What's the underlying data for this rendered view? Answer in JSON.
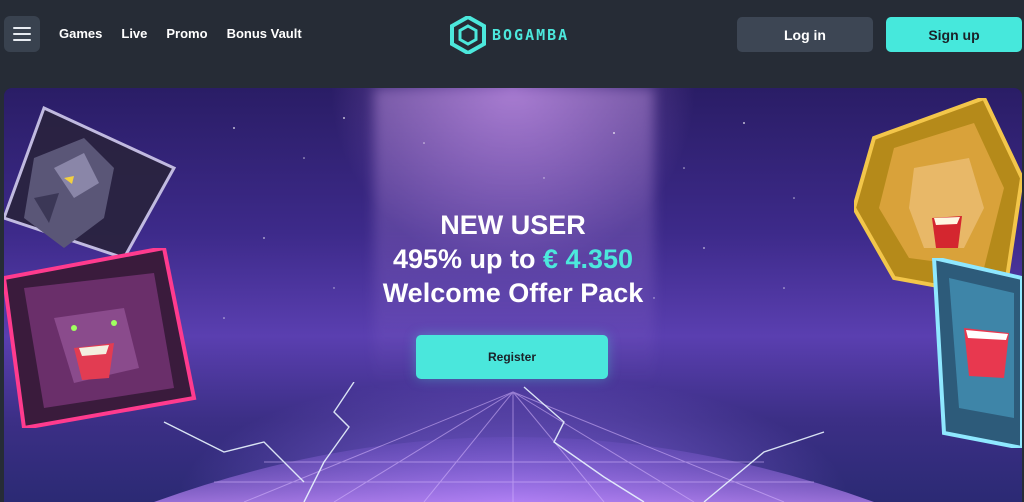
{
  "header": {
    "menu_icon": "hamburger-menu-icon",
    "nav": [
      "Games",
      "Live",
      "Promo",
      "Bonus Vault"
    ],
    "logo_text": "BOGAMBA",
    "login_label": "Log in",
    "signup_label": "Sign up"
  },
  "hero": {
    "line1": "NEW USER",
    "line2_prefix": "495% up to ",
    "line2_amount": "€ 4.350",
    "line3": "Welcome Offer Pack",
    "register_label": "Register"
  },
  "colors": {
    "accent": "#4ce8dc",
    "header_bg": "#262c36",
    "login_bg": "#3d4654"
  }
}
